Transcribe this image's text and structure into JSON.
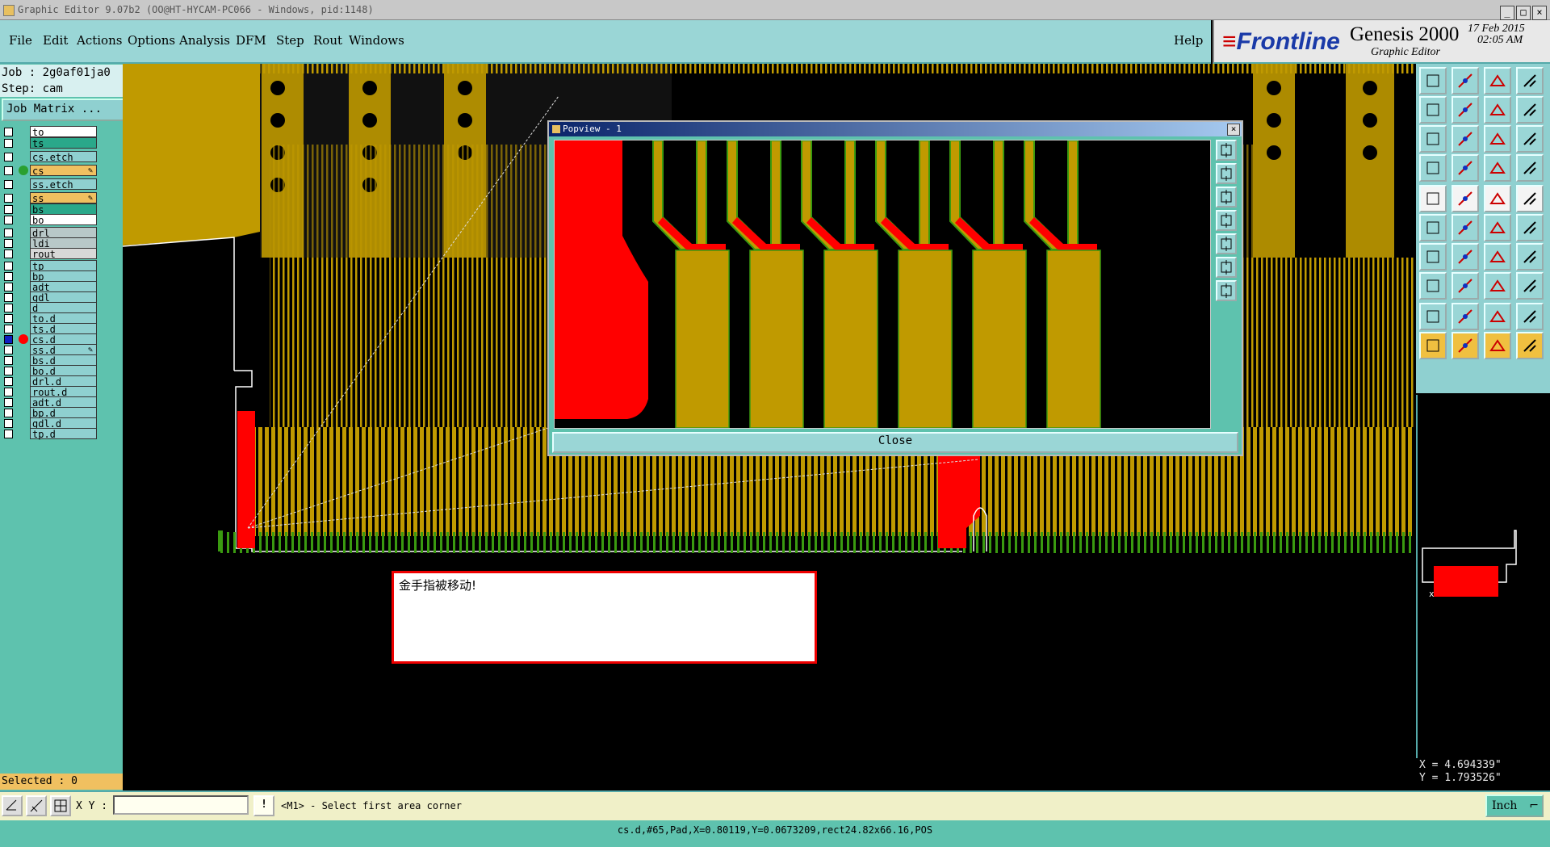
{
  "window": {
    "title": "Graphic Editor 9.07b2 (OO@HT-HYCAM-PC066 - Windows, pid:1148)"
  },
  "menu": {
    "items": [
      "File",
      "Edit",
      "Actions",
      "Options",
      "Analysis",
      "DFM",
      "Step",
      "Rout",
      "Windows"
    ],
    "help": "Help"
  },
  "brand": {
    "logo": "Frontline",
    "product": "Genesis 2000",
    "subtitle": "Graphic Editor",
    "date": "17 Feb 2015",
    "time": "02:05 AM"
  },
  "job": {
    "job_line": "Job : 2g0af01ja0",
    "step_line": "Step: cam",
    "matrix_button": "Job Matrix ..."
  },
  "layers": [
    {
      "name": "to",
      "color": "#ffffff",
      "status": ""
    },
    {
      "name": "ts",
      "color": "#2aa88a",
      "status": ""
    },
    {
      "name": "cs.etch",
      "color": "#8fd0d0",
      "status": ""
    },
    {
      "name": "cs",
      "color": "#f0c060",
      "status": "work"
    },
    {
      "name": "ss.etch",
      "color": "#8fd0d0",
      "status": ""
    },
    {
      "name": "ss",
      "color": "#f0c060",
      "status": "affected"
    },
    {
      "name": "bs",
      "color": "#2aa88a",
      "status": ""
    },
    {
      "name": "bo",
      "color": "#ffffff",
      "status": ""
    },
    {
      "name": "drl",
      "color": "#b8c8c8",
      "status": ""
    },
    {
      "name": "ldi",
      "color": "#b8c8c8",
      "status": ""
    },
    {
      "name": "rout",
      "color": "#d8d8d8",
      "status": ""
    },
    {
      "name": "tp",
      "color": "#8fd0d0",
      "status": ""
    },
    {
      "name": "bp",
      "color": "#8fd0d0",
      "status": ""
    },
    {
      "name": "adt",
      "color": "#8fd0d0",
      "status": ""
    },
    {
      "name": "gdl",
      "color": "#8fd0d0",
      "status": ""
    },
    {
      "name": "d",
      "color": "#8fd0d0",
      "status": ""
    },
    {
      "name": "to.d",
      "color": "#8fd0d0",
      "status": ""
    },
    {
      "name": "ts.d",
      "color": "#8fd0d0",
      "status": ""
    },
    {
      "name": "cs.d",
      "color": "#8fd0d0",
      "status": "display"
    },
    {
      "name": "ss.d",
      "color": "#8fd0d0",
      "status": "affected"
    },
    {
      "name": "bs.d",
      "color": "#8fd0d0",
      "status": ""
    },
    {
      "name": "bo.d",
      "color": "#8fd0d0",
      "status": ""
    },
    {
      "name": "drl.d",
      "color": "#8fd0d0",
      "status": ""
    },
    {
      "name": "rout.d",
      "color": "#8fd0d0",
      "status": ""
    },
    {
      "name": "adt.d",
      "color": "#8fd0d0",
      "status": ""
    },
    {
      "name": "bp.d",
      "color": "#8fd0d0",
      "status": ""
    },
    {
      "name": "gdl.d",
      "color": "#8fd0d0",
      "status": ""
    },
    {
      "name": "tp.d",
      "color": "#8fd0d0",
      "status": ""
    }
  ],
  "selected": "Selected : 0",
  "popview": {
    "title": "Popview - 1",
    "close": "Close"
  },
  "message": "金手指被移动!",
  "bottom": {
    "xy_label": "X Y :",
    "xy_value": "",
    "prompt": "<M1> - Select first area corner",
    "unit": "Inch"
  },
  "coords": {
    "x": "X = 4.694339\"",
    "y": "Y = 1.793526\""
  },
  "status": "cs.d,#65,Pad,X=0.80119,Y=0.0673209,rect24.82x66.16,POS",
  "colors": {
    "copper": "#c09a00",
    "highlight": "#ff0000",
    "outline": "#3a9a10",
    "panel": "#5ec2ae",
    "menu": "#9ad6d6"
  }
}
